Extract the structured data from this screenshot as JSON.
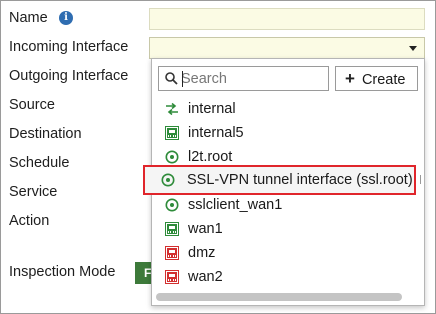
{
  "form": {
    "name_label": "Name",
    "incoming_label": "Incoming Interface",
    "outgoing_label": "Outgoing Interface",
    "source_label": "Source",
    "destination_label": "Destination",
    "schedule_label": "Schedule",
    "service_label": "Service",
    "action_label": "Action",
    "inspection_mode_label": "Inspection Mode",
    "inspection_mode_value": "F",
    "name_value": "",
    "incoming_value": ""
  },
  "dropdown": {
    "search_placeholder": "Search",
    "search_value": "",
    "create_label": "Create",
    "options": [
      {
        "label": "internal",
        "icon": "switch-icon",
        "color": "#2e8b3a"
      },
      {
        "label": "internal5",
        "icon": "port-green-icon",
        "color": "#2e8b3a"
      },
      {
        "label": "l2t.root",
        "icon": "tunnel-icon",
        "color": "#2e8b3a"
      },
      {
        "label": "SSL-VPN tunnel interface (ssl.root)",
        "icon": "tunnel-icon",
        "color": "#2e8b3a",
        "selected": true
      },
      {
        "label": "sslclient_wan1",
        "icon": "tunnel-icon",
        "color": "#2e8b3a"
      },
      {
        "label": "wan1",
        "icon": "port-green-icon",
        "color": "#2e8b3a"
      },
      {
        "label": "dmz",
        "icon": "port-red-icon",
        "color": "#d32f2f"
      },
      {
        "label": "wan2",
        "icon": "port-red-icon",
        "color": "#d32f2f"
      }
    ]
  },
  "colors": {
    "highlight_border": "#e0252b",
    "input_bg": "#fbfbe4",
    "info_icon": "#2f6db1",
    "mode_button": "#3d7a3a"
  }
}
